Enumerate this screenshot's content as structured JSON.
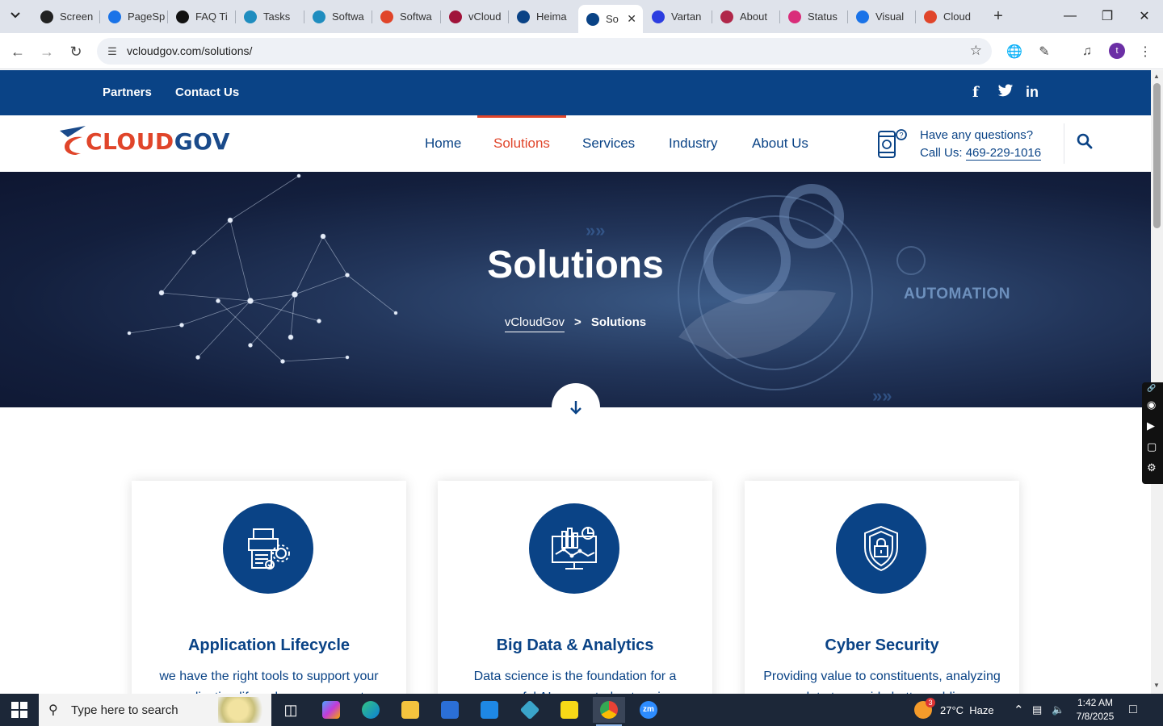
{
  "browser": {
    "tabs": [
      {
        "title": "Screen",
        "color": "#222"
      },
      {
        "title": "PageSp",
        "color": "#1a73e8"
      },
      {
        "title": "FAQ Ti",
        "color": "#111"
      },
      {
        "title": "Tasks",
        "color": "#1f8dbf"
      },
      {
        "title": "Softwa",
        "color": "#1f8dbf"
      },
      {
        "title": "Softwa",
        "color": "#e0452a"
      },
      {
        "title": "vCloud",
        "color": "#a0133a"
      },
      {
        "title": "Heima",
        "color": "#0a4386"
      },
      {
        "title": "So",
        "color": "#0a4386"
      },
      {
        "title": "Vartan",
        "color": "#2c3de0"
      },
      {
        "title": "About",
        "color": "#b0284a"
      },
      {
        "title": "Status",
        "color": "#d92d7a"
      },
      {
        "title": "Visual",
        "color": "#1a73e8"
      },
      {
        "title": "Cloud",
        "color": "#e0452a"
      }
    ],
    "active_tab_index": 8,
    "url": "vcloudgov.com/solutions/",
    "profile_initial": "t"
  },
  "site": {
    "topbar": {
      "links": [
        "Partners",
        "Contact Us"
      ],
      "social": [
        "f",
        "t",
        "in"
      ]
    },
    "logo": {
      "part1": "CLOUD",
      "part2": "GOV"
    },
    "menu": [
      "Home",
      "Solutions",
      "Services",
      "Industry",
      "About Us"
    ],
    "menu_active": "Solutions",
    "contact": {
      "line1": "Have any questions?",
      "call_prefix": "Call Us: ",
      "phone": "469-229-1016"
    },
    "hero": {
      "title": "Solutions",
      "breadcrumb_home": "vCloudGov",
      "breadcrumb_sep": ">",
      "breadcrumb_current": "Solutions",
      "background_text": "AUTOMATION"
    },
    "cards": [
      {
        "title": "Application Lifecycle",
        "desc": "we have the right tools to support your application lifecycle management",
        "icon": "app-lifecycle-icon"
      },
      {
        "title": "Big Data & Analytics",
        "desc": "Data science is the foundation for a successful AI-supported enterprise",
        "icon": "analytics-icon"
      },
      {
        "title": "Cyber Security",
        "desc": "Providing value to constituents, analyzing data to provide better public",
        "icon": "shield-lock-icon"
      }
    ]
  },
  "taskbar": {
    "search_placeholder": "Type here to search",
    "weather": {
      "temp": "27°C",
      "condition": "Haze",
      "badge": "3"
    },
    "time": "1:42 AM",
    "date": "7/8/2025"
  },
  "colors": {
    "brand_blue": "#0a4386",
    "brand_red": "#e0452a"
  }
}
